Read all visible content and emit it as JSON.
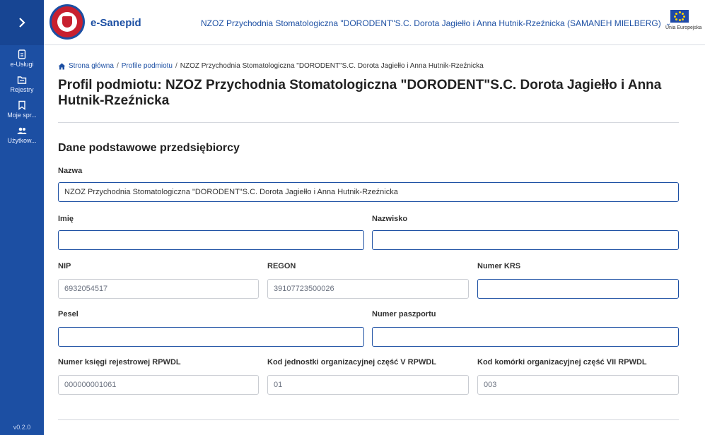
{
  "sidebar": {
    "items": [
      {
        "label": "e-Usługi",
        "icon": "document-icon"
      },
      {
        "label": "Rejestry",
        "icon": "folder-icon"
      },
      {
        "label": "Moje spr...",
        "icon": "bookmark-icon"
      },
      {
        "label": "Użytkow...",
        "icon": "users-icon"
      }
    ],
    "version": "v0.2.0"
  },
  "header": {
    "app_name": "e-Sanepid",
    "org": "NZOZ Przychodnia Stomatologiczna \"DORODENT\"S.C. Dorota Jagiełło i Anna Hutnik-Rzeźnicka (SAMANEH MIELBERG)",
    "eu_label": "Unia Europejska"
  },
  "breadcrumb": {
    "home": "Strona główna",
    "profiles": "Profile podmiotu",
    "current": "NZOZ Przychodnia Stomatologiczna \"DORODENT\"S.C. Dorota Jagiełło i Anna Hutnik-Rzeźnicka"
  },
  "page_title": "Profil podmiotu: NZOZ Przychodnia Stomatologiczna \"DORODENT\"S.C. Dorota Jagiełło i Anna Hutnik-Rzeźnicka",
  "section_title": "Dane podstawowe przedsiębiorcy",
  "fields": {
    "nazwa": {
      "label": "Nazwa",
      "value": "NZOZ Przychodnia Stomatologiczna \"DORODENT\"S.C. Dorota Jagiełło i Anna Hutnik-Rzeźnicka"
    },
    "imie": {
      "label": "Imię",
      "value": ""
    },
    "nazwisko": {
      "label": "Nazwisko",
      "value": ""
    },
    "nip": {
      "label": "NIP",
      "value": "6932054517"
    },
    "regon": {
      "label": "REGON",
      "value": "39107723500026"
    },
    "krs": {
      "label": "Numer KRS",
      "value": ""
    },
    "pesel": {
      "label": "Pesel",
      "value": ""
    },
    "paszport": {
      "label": "Numer paszportu",
      "value": ""
    },
    "ksiega": {
      "label": "Numer księgi rejestrowej RPWDL",
      "value": "000000001061"
    },
    "kod_v": {
      "label": "Kod jednostki organizacyjnej część V RPWDL",
      "value": "01"
    },
    "kod_vii": {
      "label": "Kod komórki organizacyjnej część VII RPWDL",
      "value": "003"
    }
  },
  "colors": {
    "primary": "#1c4fa3",
    "sidebar": "#1c4fa3"
  }
}
